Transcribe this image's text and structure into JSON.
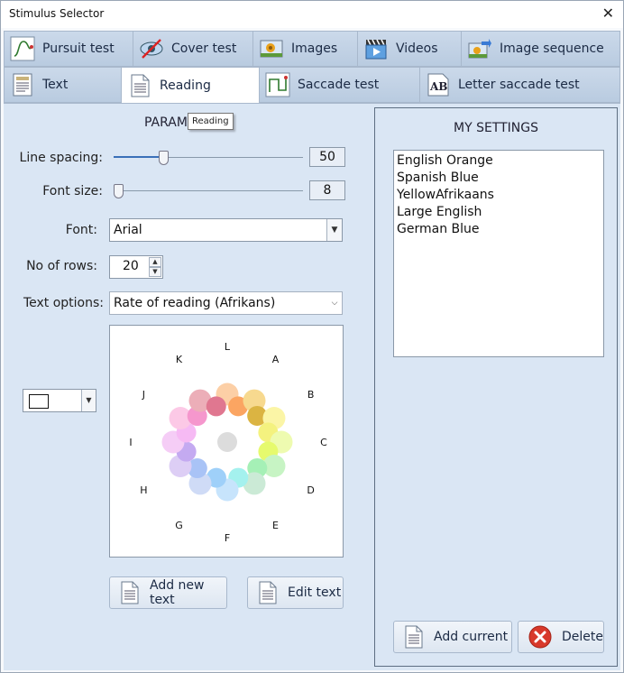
{
  "window": {
    "title": "Stimulus Selector",
    "close_glyph": "✕"
  },
  "tabs_row1": [
    {
      "label": "Pursuit test",
      "icon": "pursuit-curve-icon"
    },
    {
      "label": "Cover test",
      "icon": "cover-test-icon"
    },
    {
      "label": "Images",
      "icon": "image-icon"
    },
    {
      "label": "Videos",
      "icon": "video-icon"
    },
    {
      "label": "Image sequence",
      "icon": "image-sequence-icon"
    }
  ],
  "tabs_row2": [
    {
      "label": "Text",
      "icon": "text-document-icon"
    },
    {
      "label": "Reading",
      "icon": "document-icon",
      "active": true
    },
    {
      "label": "Saccade test",
      "icon": "saccade-icon"
    },
    {
      "label": "Letter saccade test",
      "icon": "letter-ab-icon"
    }
  ],
  "params": {
    "heading": "PARAM",
    "tooltip": "Reading",
    "line_spacing": {
      "label": "Line spacing:",
      "value": "50",
      "position": 0.25
    },
    "font_size": {
      "label": "Font size:",
      "value": "8",
      "position": 0.0
    },
    "font": {
      "label": "Font:",
      "value": "Arial"
    },
    "rows": {
      "label": "No of rows:",
      "value": "20"
    },
    "text_options": {
      "label": "Text options:",
      "value": "Rate of reading (Afrikans)"
    }
  },
  "color_wheel": {
    "letters": [
      "L",
      "A",
      "B",
      "C",
      "D",
      "E",
      "F",
      "G",
      "H",
      "I",
      "J",
      "K"
    ],
    "outer_colors": [
      "#fccfa6",
      "#f7d98f",
      "#fbf5a6",
      "#eefbb0",
      "#c7f4c4",
      "#cbead6",
      "#c7e4fc",
      "#cfdbf6",
      "#ddcef5",
      "#f5cdf6",
      "#fcc9e6",
      "#ecaeb8"
    ],
    "inner_colors": [
      "#fba562",
      "#dbb442",
      "#f4f27f",
      "#e6fa6e",
      "#a5f0b6",
      "#a4f1ee",
      "#9fd0f9",
      "#a9c3f6",
      "#c4aaf1",
      "#f6baf4",
      "#f597cd",
      "#e07790"
    ],
    "center_color": "#dcdcdc"
  },
  "buttons": {
    "add_new_text": "Add new text",
    "edit_text": "Edit text",
    "add_current": "Add current",
    "delete": "Delete"
  },
  "my_settings": {
    "heading": "MY SETTINGS",
    "items": [
      "English Orange",
      "Spanish Blue",
      "YellowAfrikaans",
      "Large English",
      "German Blue"
    ]
  }
}
